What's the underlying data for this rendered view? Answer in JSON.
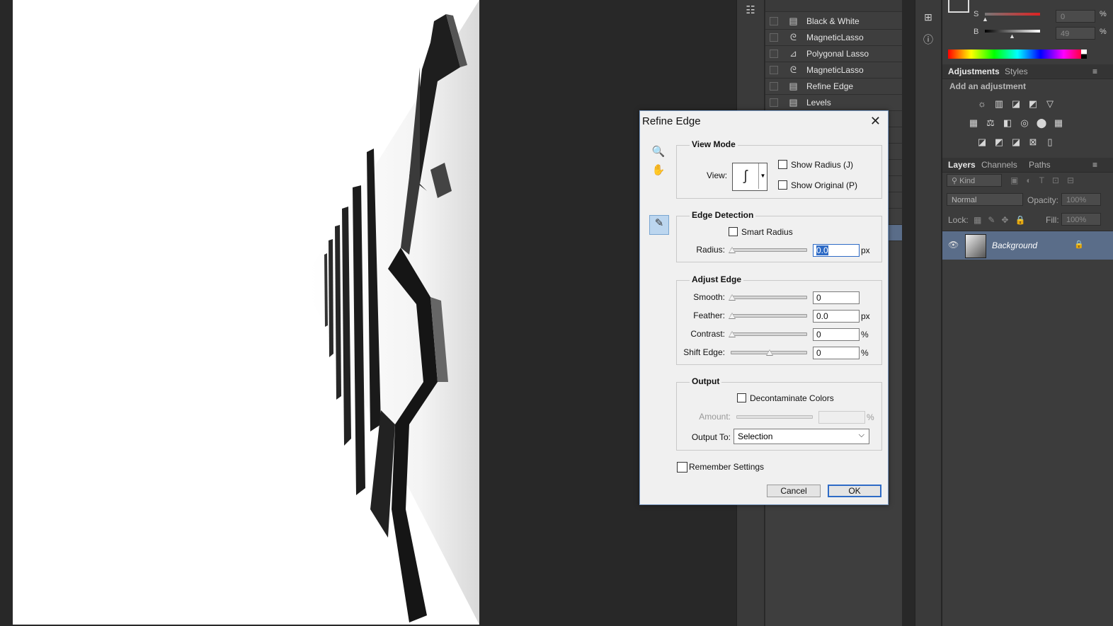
{
  "history": {
    "items": [
      {
        "label": "Black & White",
        "icon": "history-doc-icon"
      },
      {
        "label": "MagneticLasso",
        "icon": "magnetic-lasso-icon"
      },
      {
        "label": "Polygonal Lasso",
        "icon": "polygonal-lasso-icon"
      },
      {
        "label": "MagneticLasso",
        "icon": "magnetic-lasso-icon"
      },
      {
        "label": "Refine Edge",
        "icon": "history-doc-icon"
      },
      {
        "label": "Levels",
        "icon": "history-doc-icon"
      }
    ]
  },
  "color": {
    "s_label": "S",
    "b_label": "B",
    "s_value": "0",
    "b_value": "49",
    "percent": "%"
  },
  "adjustments": {
    "tabs": [
      "Adjustments",
      "Styles"
    ],
    "subtitle": "Add an adjustment"
  },
  "layers": {
    "tabs": [
      "Layers",
      "Channels",
      "Paths"
    ],
    "filter": "Kind",
    "blend_mode": "Normal",
    "opacity_label": "Opacity:",
    "opacity_value": "100%",
    "lock_label": "Lock:",
    "fill_label": "Fill:",
    "fill_value": "100%",
    "layer_name": "Background"
  },
  "dialog": {
    "title": "Refine Edge",
    "view_mode": {
      "title": "View Mode",
      "view_label": "View:",
      "show_radius": "Show Radius (J)",
      "show_original": "Show Original (P)"
    },
    "edge_detection": {
      "title": "Edge Detection",
      "smart_radius": "Smart Radius",
      "radius_label": "Radius:",
      "radius_value": "0.0",
      "radius_unit": "px"
    },
    "adjust_edge": {
      "title": "Adjust Edge",
      "smooth_label": "Smooth:",
      "smooth_value": "0",
      "feather_label": "Feather:",
      "feather_value": "0.0",
      "feather_unit": "px",
      "contrast_label": "Contrast:",
      "contrast_value": "0",
      "contrast_unit": "%",
      "shift_label": "Shift Edge:",
      "shift_value": "0",
      "shift_unit": "%"
    },
    "output": {
      "title": "Output",
      "decontaminate": "Decontaminate Colors",
      "amount_label": "Amount:",
      "amount_unit": "%",
      "output_to_label": "Output To:",
      "output_to_value": "Selection"
    },
    "remember": "Remember Settings",
    "cancel": "Cancel",
    "ok": "OK"
  },
  "colors": {
    "accent": "#2e6bc6",
    "panel": "#3c3c3c",
    "dialog_bg": "#f0f0f0"
  }
}
